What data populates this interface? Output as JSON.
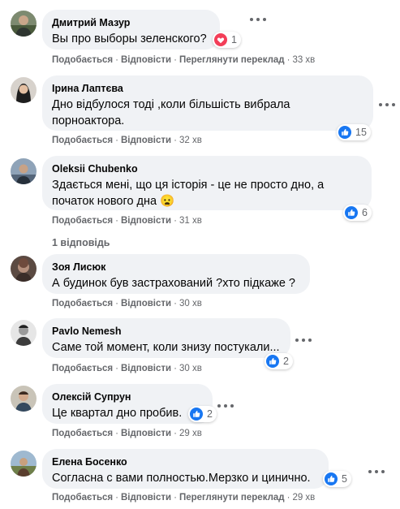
{
  "colors": {
    "like_blue": "#1877f2",
    "heart_red": "#f33e58",
    "bubble_bg": "#f0f2f5",
    "meta_gray": "#65676b"
  },
  "labels": {
    "like": "Подобається",
    "reply": "Відповісти",
    "translate": "Переглянути переклад",
    "sep": "·"
  },
  "comments": [
    {
      "author": "Дмитрий Мазур",
      "text": "Вы про выборы зеленского?",
      "reaction_icon": "heart-icon",
      "reaction_count": "1",
      "time": "33 хв",
      "has_translate": true
    },
    {
      "author": "Ірина Лаптєва",
      "text": "Дно відбулося тоді ,коли більшість вибрала порноактора.",
      "reaction_icon": "like-icon",
      "reaction_count": "15",
      "time": "32 хв",
      "has_translate": false
    },
    {
      "author": "Oleksii Chubenko",
      "text": "Здається мені, що ця історія - це не просто дно, а початок нового дна",
      "emoji": "😦",
      "reaction_icon": "like-icon",
      "reaction_count": "6",
      "time": "31 хв",
      "has_translate": false
    },
    {
      "author": "Зоя Лисюк",
      "text": "А будинок був застрахований ?хто підкаже ?",
      "time": "30 хв",
      "has_translate": false
    },
    {
      "author": "Pavlo Nemesh",
      "text": "Саме той момент, коли знизу постукали...",
      "reaction_icon": "like-icon",
      "reaction_count": "2",
      "time": "30 хв",
      "has_translate": false
    },
    {
      "author": "Олексій Супрун",
      "text": "Це квартал дно пробив.",
      "reaction_icon": "like-icon",
      "reaction_count": "2",
      "time": "29 хв",
      "has_translate": false
    },
    {
      "author": "Елена Босенко",
      "text": "Согласна с вами полностью.Мерзко и цинично.",
      "reaction_icon": "like-icon",
      "reaction_count": "5",
      "time": "29 хв",
      "has_translate": true
    }
  ],
  "replies_link": "1 відповідь"
}
